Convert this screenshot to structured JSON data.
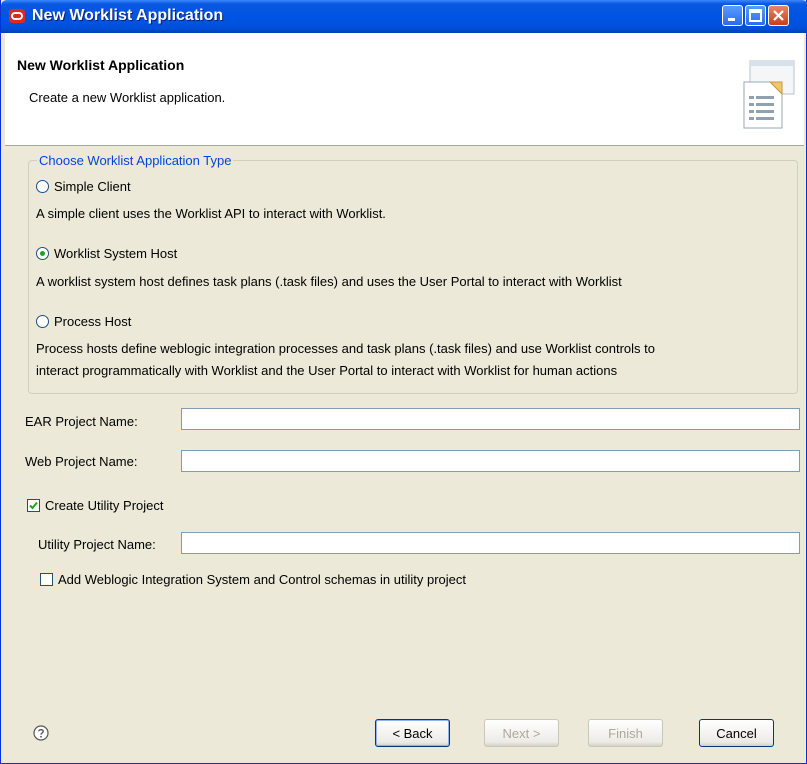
{
  "window": {
    "title": "New Worklist Application"
  },
  "header": {
    "title": "New Worklist Application",
    "description": "Create a new Worklist application."
  },
  "app_type_group": {
    "legend": "Choose Worklist Application Type",
    "options": [
      {
        "label": "Simple Client",
        "description": "A simple client uses the Worklist API to interact with Worklist.",
        "selected": false
      },
      {
        "label": "Worklist System Host",
        "description": "A worklist system host defines task plans (.task files) and uses the User Portal to interact with Worklist",
        "selected": true
      },
      {
        "label": "Process Host",
        "description_line1": "Process hosts define weblogic integration processes and task plans (.task files) and use Worklist controls to",
        "description_line2": "interact programmatically with Worklist and the User Portal to interact with Worklist for human actions",
        "selected": false
      }
    ]
  },
  "fields": {
    "ear_label": "EAR Project Name:",
    "ear_value": "",
    "web_label": "Web Project Name:",
    "web_value": "",
    "create_utility_label": "Create Utility Project",
    "create_utility_checked": true,
    "utility_label": "Utility Project Name:",
    "utility_value": "",
    "add_schemas_label": "Add Weblogic Integration System and Control schemas in utility project",
    "add_schemas_checked": false
  },
  "buttons": {
    "back": "< Back",
    "next": "Next >",
    "finish": "Finish",
    "cancel": "Cancel"
  },
  "colors": {
    "titlebar": "#0054e3",
    "legend_text": "#0046d5",
    "dialog_bg": "#ece9d8",
    "check_green": "#21a121"
  }
}
